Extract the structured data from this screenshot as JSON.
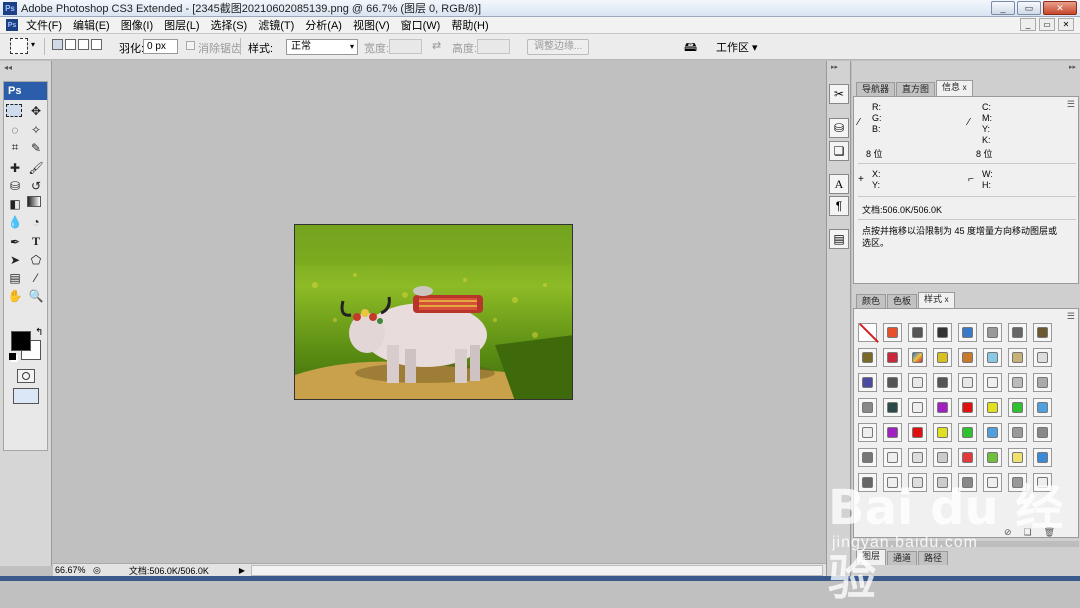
{
  "window": {
    "title": "Adobe Photoshop CS3 Extended - [2345截图20210602085139.png @ 66.7% (图层 0, RGB/8)]",
    "app_logo": "Ps",
    "minimize": "_",
    "restore": "▭",
    "close": "✕"
  },
  "menubar": {
    "logo": "Ps",
    "items": [
      "文件(F)",
      "编辑(E)",
      "图像(I)",
      "图层(L)",
      "选择(S)",
      "滤镜(T)",
      "分析(A)",
      "视图(V)",
      "窗口(W)",
      "帮助(H)"
    ]
  },
  "options": {
    "feather_label": "羽化:",
    "feather_value": "0 px",
    "antialias_label": "消除锯齿",
    "style_label": "样式:",
    "style_value": "正常",
    "width_label": "宽度:",
    "height_label": "高度:",
    "refine_button": "调整边缘...",
    "workspace_label": "工作区 ▾"
  },
  "toolbox": {
    "header": "Ps"
  },
  "statusbar": {
    "zoom": "66.67%",
    "doc_size": "文档:506.0K/506.0K"
  },
  "info_panel": {
    "tabs": [
      "导航器",
      "直方图",
      "信息"
    ],
    "active_tab": "信息",
    "rgb_labels": [
      "R:",
      "G:",
      "B:"
    ],
    "cmyk_labels": [
      "C:",
      "M:",
      "Y:",
      "K:"
    ],
    "bit_left": "8 位",
    "bit_right": "8 位",
    "xy_labels": [
      "X:",
      "Y:"
    ],
    "wh_labels": [
      "W:",
      "H:"
    ],
    "doc_info": "文档:506.0K/506.0K",
    "hint": "点按并拖移以沿限制为 45 度增量方向移动图层或选区。"
  },
  "styles_panel": {
    "tabs": [
      "颜色",
      "色板",
      "样式"
    ],
    "active_tab": "样式"
  },
  "layers_panel": {
    "tabs": [
      "图层",
      "通道",
      "路径"
    ]
  },
  "watermark": {
    "logo_text": "Bai du 经验",
    "url": "jingyan.baidu.com"
  },
  "colors": {
    "toolbox_header": "#2c5dab",
    "foreground": "#000000",
    "background": "#ffffff"
  }
}
